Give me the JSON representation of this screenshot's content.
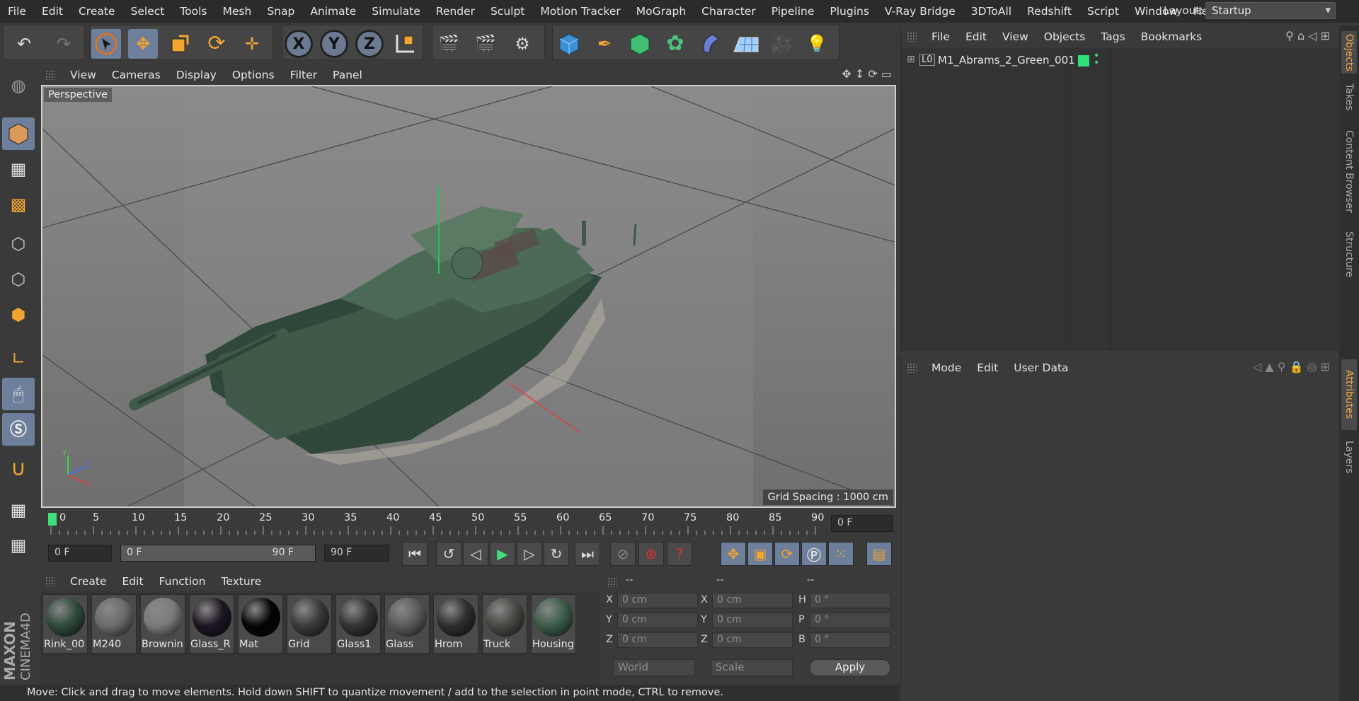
{
  "menubar": {
    "items": [
      "File",
      "Edit",
      "Create",
      "Select",
      "Tools",
      "Mesh",
      "Snap",
      "Animate",
      "Simulate",
      "Render",
      "Sculpt",
      "Motion Tracker",
      "MoGraph",
      "Character",
      "Pipeline",
      "Plugins",
      "V-Ray Bridge",
      "3DToAll",
      "Redshift",
      "Script",
      "Window",
      "Help"
    ],
    "layout_label": "Layout:",
    "layout_value": "Startup"
  },
  "toolbar": {
    "axis_x": "X",
    "axis_y": "Y",
    "axis_z": "Z"
  },
  "viewport": {
    "menu": [
      "View",
      "Cameras",
      "Display",
      "Options",
      "Filter",
      "Panel"
    ],
    "label": "Perspective",
    "grid_spacing": "Grid Spacing : 1000 cm",
    "axis_y": "Y",
    "axis_z": "Z",
    "axis_x": "X"
  },
  "timeline": {
    "ticks": [
      "0",
      "5",
      "10",
      "15",
      "20",
      "25",
      "30",
      "35",
      "40",
      "45",
      "50",
      "55",
      "60",
      "65",
      "70",
      "75",
      "80",
      "85",
      "90"
    ],
    "current_frame": "0 F"
  },
  "playbar": {
    "start_frame": "0 F",
    "range_start": "0 F",
    "range_end": "90 F",
    "end_frame": "90 F"
  },
  "materials": {
    "menu": [
      "Create",
      "Edit",
      "Function",
      "Texture"
    ],
    "items": [
      {
        "name": "Rink_00",
        "color": "#2f4a3c"
      },
      {
        "name": "M240",
        "color": "#6b6b6b"
      },
      {
        "name": "Brownin",
        "color": "#7a7a7a"
      },
      {
        "name": "Glass_R",
        "color": "#1e1622"
      },
      {
        "name": "Mat",
        "color": "#050505"
      },
      {
        "name": "Grid",
        "color": "#3a3a3a"
      },
      {
        "name": "Glass1",
        "color": "#333333"
      },
      {
        "name": "Glass",
        "color": "#5a5a5a"
      },
      {
        "name": "Hrom",
        "color": "#2e2e2e"
      },
      {
        "name": "Truck",
        "color": "#4a4844"
      },
      {
        "name": "Housing",
        "color": "#3c5c4a"
      }
    ]
  },
  "coords": {
    "headers": [
      "--",
      "--",
      "--"
    ],
    "rows": [
      {
        "a": "X",
        "av": "0 cm",
        "b": "X",
        "bv": "0 cm",
        "c": "H",
        "cv": "0 °"
      },
      {
        "a": "Y",
        "av": "0 cm",
        "b": "Y",
        "bv": "0 cm",
        "c": "P",
        "cv": "0 °"
      },
      {
        "a": "Z",
        "av": "0 cm",
        "b": "Z",
        "bv": "0 cm",
        "c": "B",
        "cv": "0 °"
      }
    ],
    "mode_world": "World",
    "mode_scale": "Scale",
    "apply": "Apply"
  },
  "objects_panel": {
    "menu": [
      "File",
      "Edit",
      "View",
      "Objects",
      "Tags",
      "Bookmarks"
    ],
    "object_name": "M1_Abrams_2_Green_001",
    "object_prefix": "L0"
  },
  "attributes_panel": {
    "menu": [
      "Mode",
      "Edit",
      "User Data"
    ]
  },
  "side_tabs": [
    "Objects",
    "Takes",
    "Content Browser",
    "Structure",
    "Attributes",
    "Layers"
  ],
  "status": "Move: Click and drag to move elements. Hold down SHIFT to quantize movement / add to the selection in point mode, CTRL to remove.",
  "brand": {
    "line1": "MAXON",
    "line2": "CINEMA4D"
  },
  "colors": {
    "accent": "#6d7f9a",
    "tank": "#3f5a48",
    "tag": "#2ee07a"
  }
}
